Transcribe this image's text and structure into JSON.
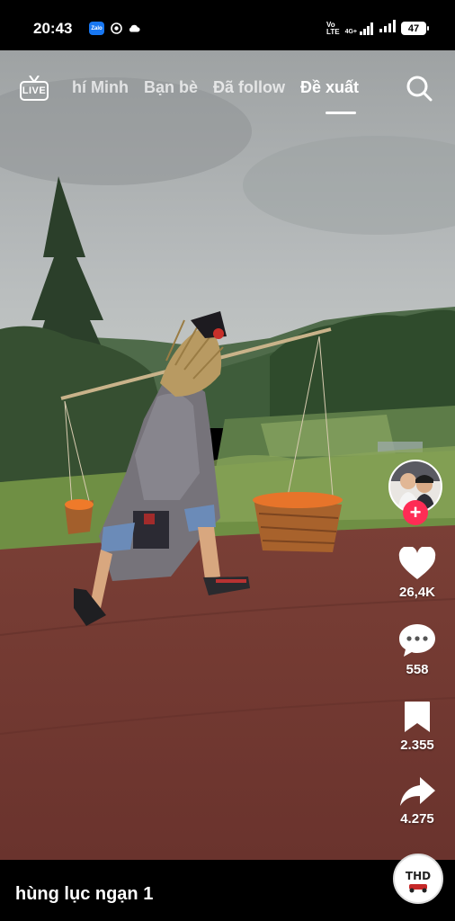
{
  "status_bar": {
    "time": "20:43",
    "zalo_label": "Zalo",
    "network": "4G+",
    "volte_top": "Vo",
    "volte_bottom": "LTE",
    "battery": "47"
  },
  "nav": {
    "live_label": "LIVE",
    "tabs": [
      {
        "label": "hí Minh"
      },
      {
        "label": "Bạn bè"
      },
      {
        "label": "Đã follow"
      },
      {
        "label": "Đề xuất",
        "active": true
      }
    ]
  },
  "actions": {
    "likes": "26,4K",
    "comments": "558",
    "saves": "2.355",
    "shares": "4.275"
  },
  "follow_symbol": "+",
  "music": {
    "title": "hùng lục ngạn 1",
    "disc_text": "THD"
  },
  "colors": {
    "accent": "#fe2c55",
    "background": "#000000"
  }
}
